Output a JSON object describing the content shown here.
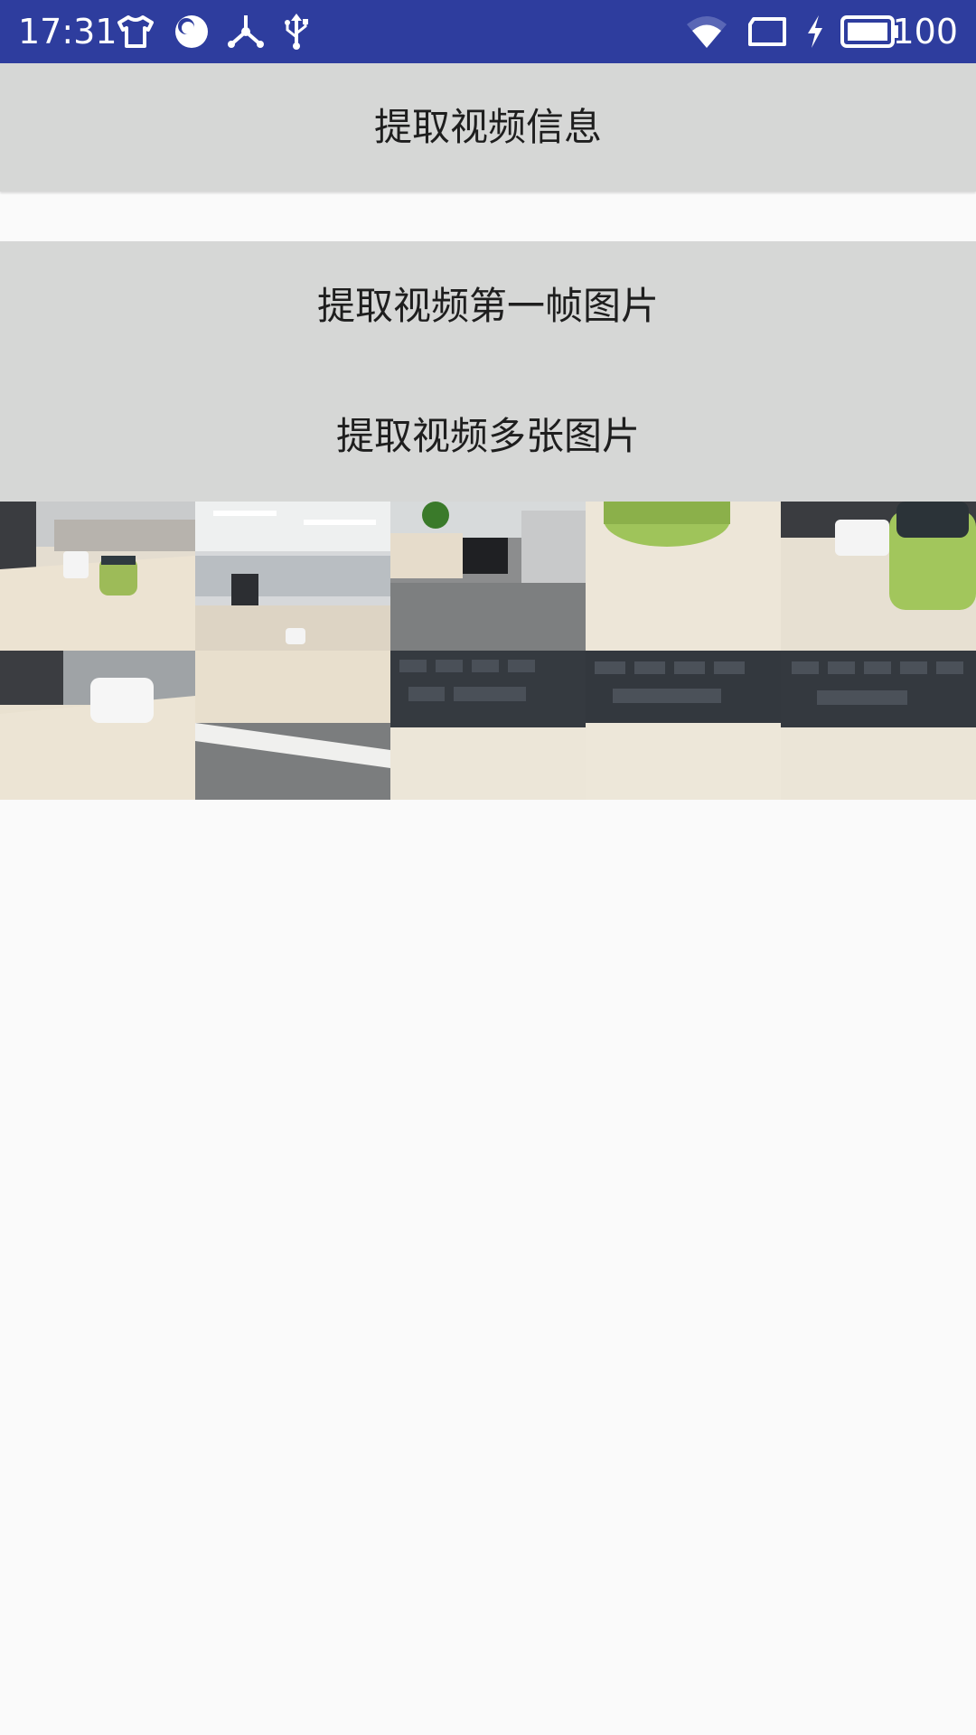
{
  "status_bar": {
    "time": "17:31",
    "battery": "100",
    "icons": [
      "tshirt-icon",
      "bubble-icon",
      "fan-icon",
      "usb-icon",
      "wifi-icon",
      "tablet-icon",
      "charging-icon",
      "battery-icon"
    ],
    "color": "#2e3d9e"
  },
  "buttons": {
    "extract_info": "提取视频信息",
    "extract_first_frame": "提取视频第一帧图片",
    "extract_multiple_frames": "提取视频多张图片"
  },
  "frames": [
    {
      "scene": "desk-mug-jar"
    },
    {
      "scene": "office-ceiling"
    },
    {
      "scene": "office-carpet-chair"
    },
    {
      "scene": "jar-closeup"
    },
    {
      "scene": "jar-mug-closeup"
    },
    {
      "scene": "mug-desk"
    },
    {
      "scene": "desk-edge-carpet"
    },
    {
      "scene": "keyboard"
    },
    {
      "scene": "keyboard"
    },
    {
      "scene": "keyboard"
    }
  ]
}
